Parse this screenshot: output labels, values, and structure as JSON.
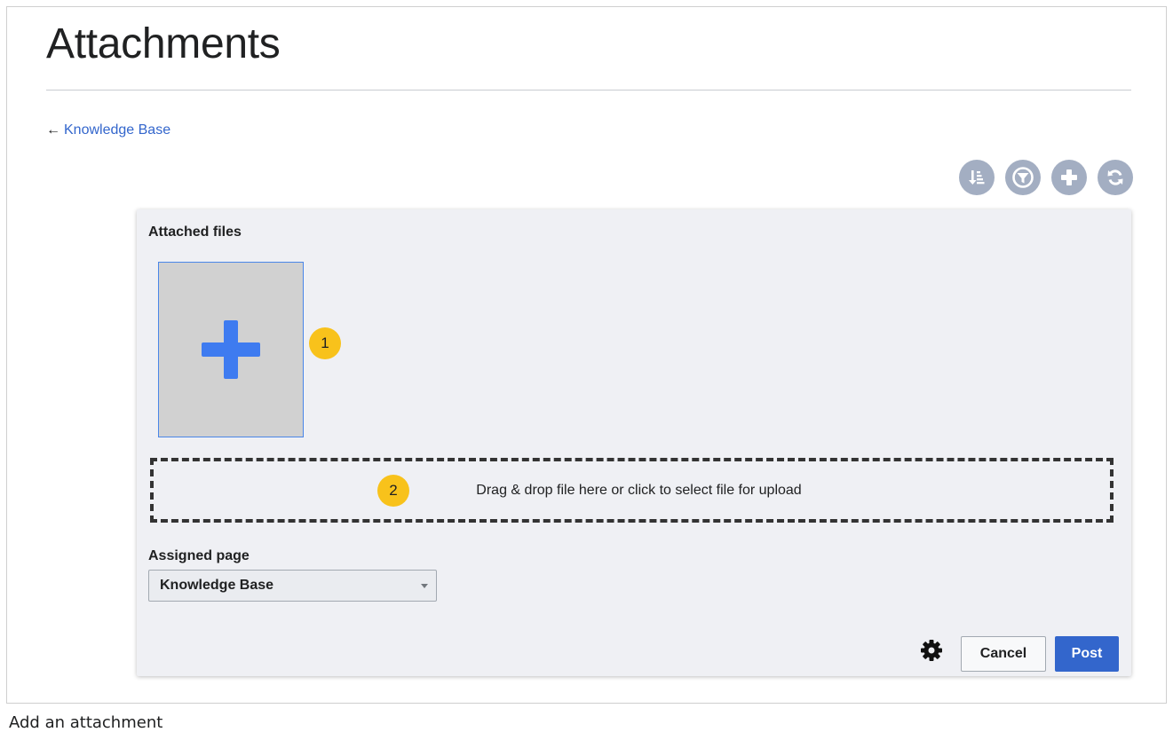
{
  "page": {
    "title": "Attachments",
    "back_arrow": "←",
    "back_link": "Knowledge Base"
  },
  "toolbar": {
    "buttons": [
      {
        "icon": "sort-icon"
      },
      {
        "icon": "filter-icon"
      },
      {
        "icon": "plus-icon"
      },
      {
        "icon": "refresh-icon"
      }
    ]
  },
  "dialog": {
    "attached_files_label": "Attached files",
    "markers": [
      "1",
      "2"
    ],
    "dropzone_text": "Drag & drop file here or click to select file for upload",
    "assigned_page_label": "Assigned page",
    "assigned_page_value": "Knowledge Base",
    "cancel_label": "Cancel",
    "post_label": "Post"
  },
  "caption": "Add an attachment",
  "colors": {
    "link": "#3366cc",
    "toolbar_icon_bg": "#a3aec2",
    "marker": "#f8c21b",
    "plus_blue": "#3e7bf0",
    "primary_button": "#3366cc",
    "panel_bg": "#eff0f4"
  }
}
